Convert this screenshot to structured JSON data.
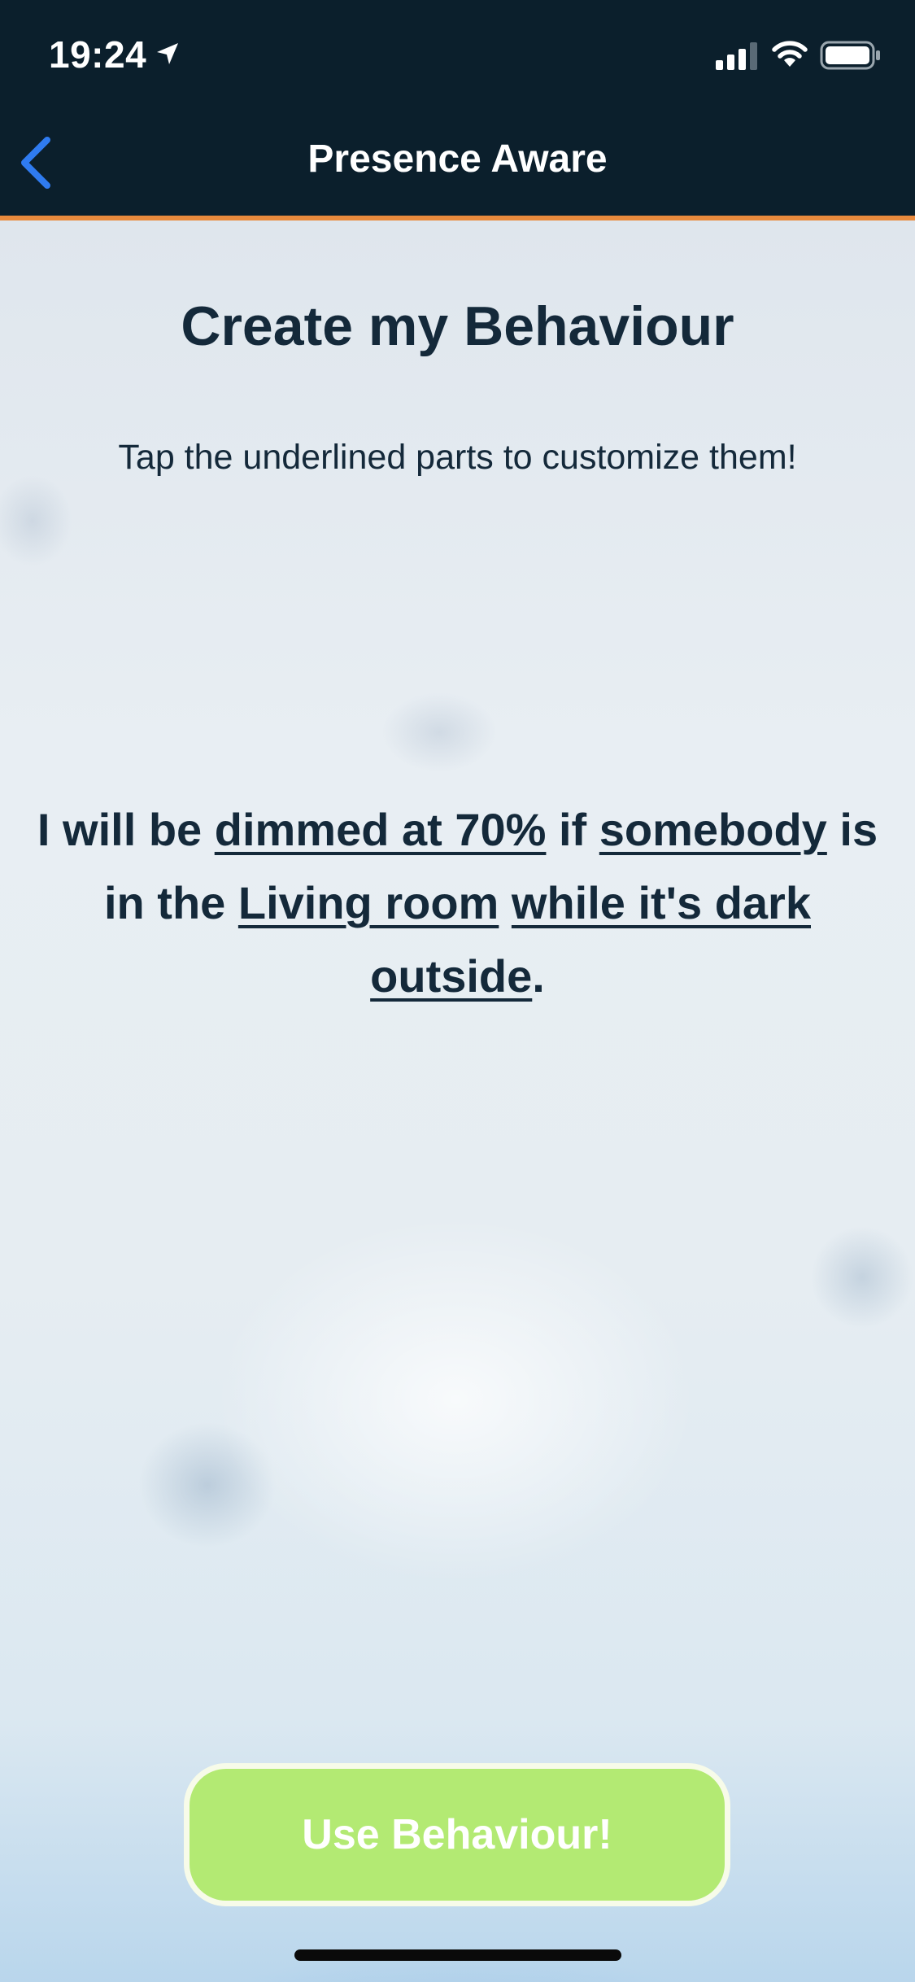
{
  "status_bar": {
    "time": "19:24",
    "icons": [
      "location-arrow-icon",
      "cellular-signal-icon",
      "wifi-icon",
      "battery-icon"
    ]
  },
  "nav": {
    "title": "Presence Aware",
    "back_icon": "chevron-left-icon"
  },
  "main": {
    "title": "Create my Behaviour",
    "subtitle": "Tap the underlined parts to customize them!",
    "sentence": {
      "p1": "I will be ",
      "action": "dimmed at 70%",
      "p2": " if ",
      "who": "somebody",
      "p3": " is in the ",
      "location": "Living room",
      "p4": " ",
      "condition": "while it's dark outside",
      "p5": "."
    }
  },
  "footer": {
    "button_label": "Use Behaviour!"
  },
  "colors": {
    "nav_background": "#0b1f2c",
    "accent_line": "#e98a3d",
    "text": "#14293a",
    "button": "#b3ea73",
    "back_chevron": "#2f7bf0"
  }
}
